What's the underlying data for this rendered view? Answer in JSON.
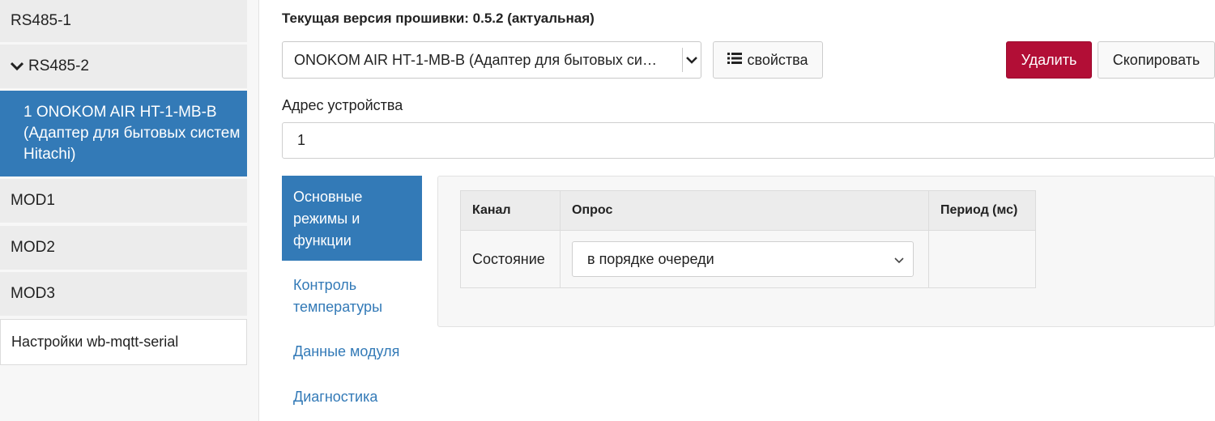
{
  "sidebar": {
    "items": [
      {
        "label": "RS485-1"
      },
      {
        "label": "RS485-2"
      },
      {
        "label": "1 ONOKOM AIR HT-1-MB-B (Адаптер для бытовых систем Hitachi)"
      },
      {
        "label": "MOD1"
      },
      {
        "label": "MOD2"
      },
      {
        "label": "MOD3"
      },
      {
        "label": "Настройки wb-mqtt-serial"
      }
    ]
  },
  "header": {
    "firmware": "Текущая версия прошивки: 0.5.2 (актуальная)"
  },
  "device_select": {
    "value": "ONOKOM AIR HT-1-MB-B (Адаптер для бытовых си…"
  },
  "buttons": {
    "properties": "свойства",
    "delete": "Удалить",
    "copy": "Скопировать"
  },
  "address": {
    "label": "Адрес устройства",
    "value": "1"
  },
  "tabs": [
    {
      "label": "Основные режимы и функции"
    },
    {
      "label": "Контроль температуры"
    },
    {
      "label": "Данные модуля"
    },
    {
      "label": "Диагностика"
    }
  ],
  "table": {
    "headers": [
      "Канал",
      "Опрос",
      "Период (мс)"
    ],
    "rows": [
      {
        "channel": "Состояние",
        "poll": "в порядке очереди",
        "period": ""
      }
    ]
  },
  "colors": {
    "accent": "#337ab7",
    "danger": "#b20e36"
  }
}
